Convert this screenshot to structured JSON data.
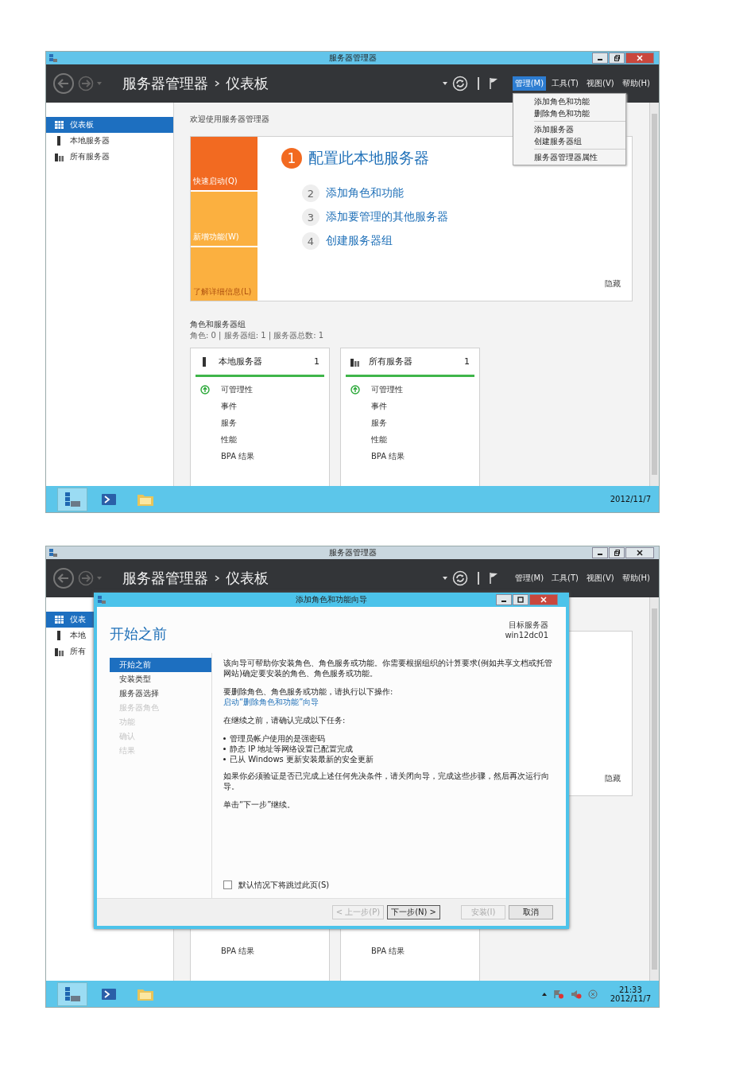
{
  "screenshots": [
    {
      "window": {
        "title": "服务器管理器",
        "active": true
      },
      "header": {
        "breadcrumb": "服务器管理器",
        "page": "仪表板"
      },
      "menus": [
        {
          "label": "管理(M)",
          "selected": true
        },
        {
          "label": "工具(T)",
          "selected": false
        },
        {
          "label": "视图(V)",
          "selected": false
        },
        {
          "label": "帮助(H)",
          "selected": false
        }
      ],
      "dropdown": {
        "groups": [
          [
            "添加角色和功能",
            "删除角色和功能"
          ],
          [
            "添加服务器",
            "创建服务器组"
          ],
          [
            "服务器管理器属性"
          ]
        ]
      },
      "sidebar": {
        "items": [
          {
            "label": "仪表板",
            "kind": "dashboard",
            "selected": true
          },
          {
            "label": "本地服务器",
            "kind": "server",
            "selected": false
          },
          {
            "label": "所有服务器",
            "kind": "servers",
            "selected": false
          }
        ]
      },
      "welcome": "欢迎使用服务器管理器",
      "quick_start": {
        "tiles": [
          {
            "label": "快速启动(Q)",
            "selected": true
          },
          {
            "label": "新增功能(W)",
            "selected": false
          },
          {
            "label": "了解详细信息(L)",
            "selected": false
          }
        ],
        "steps": [
          {
            "number": "1",
            "label": "配置此本地服务器",
            "kind": "primary"
          },
          {
            "number": "2",
            "label": "添加角色和功能",
            "kind": "secondary"
          },
          {
            "number": "3",
            "label": "添加要管理的其他服务器",
            "kind": "secondary"
          },
          {
            "number": "4",
            "label": "创建服务器组",
            "kind": "secondary"
          }
        ],
        "hide": "隐藏"
      },
      "roles": {
        "title": "角色和服务器组",
        "summary": "角色: 0 | 服务器组: 1 | 服务器总数: 1",
        "cards": [
          {
            "title": "本地服务器",
            "count": "1",
            "kind": "server",
            "rows": [
              {
                "label": "可管理性",
                "healthy": true
              },
              {
                "label": "事件",
                "healthy": false
              },
              {
                "label": "服务",
                "healthy": false
              },
              {
                "label": "性能",
                "healthy": false
              },
              {
                "label": "BPA 结果",
                "healthy": false
              }
            ]
          },
          {
            "title": "所有服务器",
            "count": "1",
            "kind": "servers",
            "rows": [
              {
                "label": "可管理性",
                "healthy": true
              },
              {
                "label": "事件",
                "healthy": false
              },
              {
                "label": "服务",
                "healthy": false
              },
              {
                "label": "性能",
                "healthy": false
              },
              {
                "label": "BPA 结果",
                "healthy": false
              }
            ]
          }
        ]
      },
      "taskbar": {
        "apps": [
          {
            "selected": true
          },
          {
            "selected": false
          },
          {
            "selected": false
          }
        ],
        "date": "2012/11/7"
      }
    },
    {
      "window": {
        "title": "服务器管理器",
        "active": false
      },
      "header": {
        "breadcrumb": "服务器管理器",
        "page": "仪表板"
      },
      "menus": [
        {
          "label": "管理(M)",
          "selected": false
        },
        {
          "label": "工具(T)",
          "selected": false
        },
        {
          "label": "视图(V)",
          "selected": false
        },
        {
          "label": "帮助(H)",
          "selected": false
        }
      ],
      "sidebar": {
        "items": [
          {
            "label": "仪表",
            "kind": "dashboard",
            "selected": true
          },
          {
            "label": "本地",
            "kind": "server",
            "selected": false
          },
          {
            "label": "所有",
            "kind": "servers",
            "selected": false
          }
        ]
      },
      "quick_start": {
        "hide": "隐藏"
      },
      "roles": {
        "cards": [
          {
            "rows": [
              {
                "label": "BPA 结果",
                "healthy": false
              }
            ]
          },
          {
            "rows": [
              {
                "label": "BPA 结果",
                "healthy": false
              }
            ]
          }
        ]
      },
      "dialog": {
        "title": "添加角色和功能向导",
        "heading": "开始之前",
        "target_label": "目标服务器",
        "target": "win12dc01",
        "steps": [
          {
            "label": "开始之前",
            "selected": true,
            "disabled": false
          },
          {
            "label": "安装类型",
            "selected": false,
            "disabled": false
          },
          {
            "label": "服务器选择",
            "selected": false,
            "disabled": false
          },
          {
            "label": "服务器角色",
            "selected": false,
            "disabled": true
          },
          {
            "label": "功能",
            "selected": false,
            "disabled": true
          },
          {
            "label": "确认",
            "selected": false,
            "disabled": true
          },
          {
            "label": "结果",
            "selected": false,
            "disabled": true
          }
        ],
        "content": [
          {
            "kind": "text",
            "text": "该向导可帮助你安装角色、角色服务或功能。你需要根据组织的计算要求(例如共享文档或托管网站)确定要安装的角色、角色服务或功能。"
          },
          {
            "kind": "text",
            "text": "要删除角色、角色服务或功能，请执行以下操作:"
          },
          {
            "kind": "link",
            "text": "启动“删除角色和功能”向导"
          },
          {
            "kind": "text",
            "text": "在继续之前，请确认完成以下任务:"
          },
          {
            "kind": "bullets",
            "items": [
              "管理员帐户使用的是强密码",
              "静态 IP 地址等网络设置已配置完成",
              "已从 Windows 更新安装最新的安全更新"
            ]
          },
          {
            "kind": "text",
            "text": "如果你必须验证是否已完成上述任何先决条件，请关闭向导，完成这些步骤，然后再次运行向导。"
          },
          {
            "kind": "text",
            "text": "单击“下一步”继续。"
          }
        ],
        "skip_checkbox": {
          "label": "默认情况下将跳过此页(S)",
          "checked": false
        },
        "buttons": [
          {
            "label": "< 上一步(P)",
            "disabled": true,
            "focused": false
          },
          {
            "label": "下一步(N) >",
            "disabled": false,
            "focused": true
          },
          {
            "label": "安装(I)",
            "disabled": true,
            "focused": false
          },
          {
            "label": "取消",
            "disabled": false,
            "focused": false
          }
        ]
      },
      "taskbar": {
        "apps": [
          {
            "selected": true
          },
          {
            "selected": false
          },
          {
            "selected": false
          }
        ],
        "tray": true,
        "time": "21:33",
        "date": "2012/11/7"
      }
    }
  ]
}
